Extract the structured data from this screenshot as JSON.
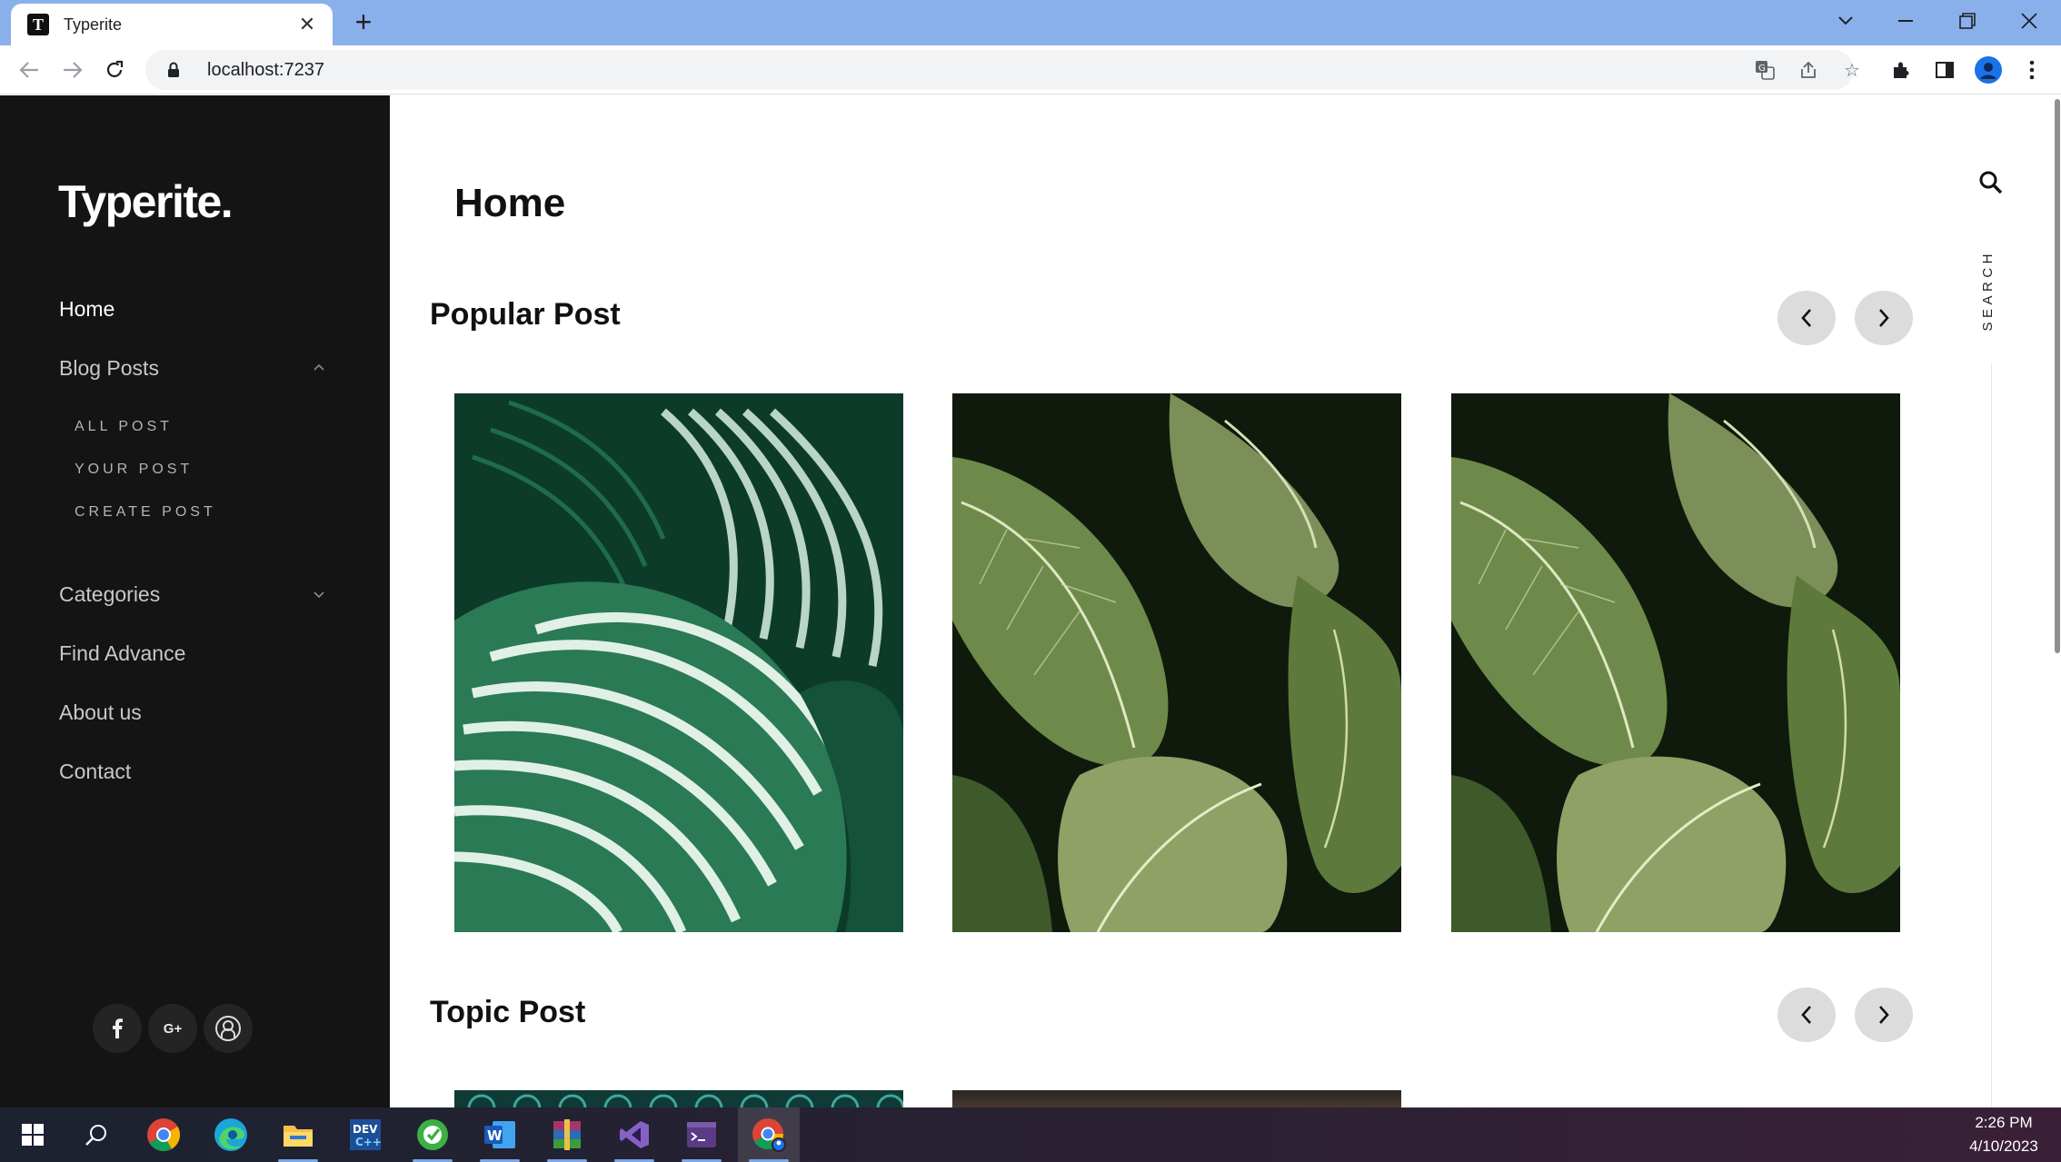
{
  "browser": {
    "tab_title": "Typerite",
    "favicon_letter": "T",
    "url": "localhost:7237"
  },
  "sidebar": {
    "brand": "Typerite.",
    "nav": [
      {
        "label": "Home",
        "active": true
      },
      {
        "label": "Blog Posts",
        "expanded": true
      },
      {
        "label": "Categories",
        "expanded": false
      },
      {
        "label": "Find Advance"
      },
      {
        "label": "About us"
      },
      {
        "label": "Contact"
      }
    ],
    "blog_sub": [
      "ALL POST",
      "YOUR POST",
      "CREATE POST"
    ],
    "social": [
      "facebook-icon",
      "google-plus-icon",
      "user-circle-icon"
    ],
    "google_plus_text": "G+"
  },
  "main": {
    "page_title": "Home",
    "sections": [
      {
        "title": "Popular Post"
      },
      {
        "title": "Topic Post"
      }
    ],
    "search_label": "SEARCH"
  },
  "taskbar": {
    "time": "2:26 PM",
    "date": "4/10/2023",
    "apps": [
      "start-icon",
      "search-icon",
      "chrome-icon",
      "edge-icon",
      "file-explorer-icon",
      "devcpp-icon",
      "app-green-icon",
      "word-icon",
      "winrar-icon",
      "visual-studio-icon",
      "terminal-icon",
      "chrome-profile-icon"
    ]
  },
  "colors": {
    "sidebar_bg": "#141414",
    "tabstrip_bg": "#8ab0ec",
    "arrow_bg": "#dcdcdc"
  }
}
